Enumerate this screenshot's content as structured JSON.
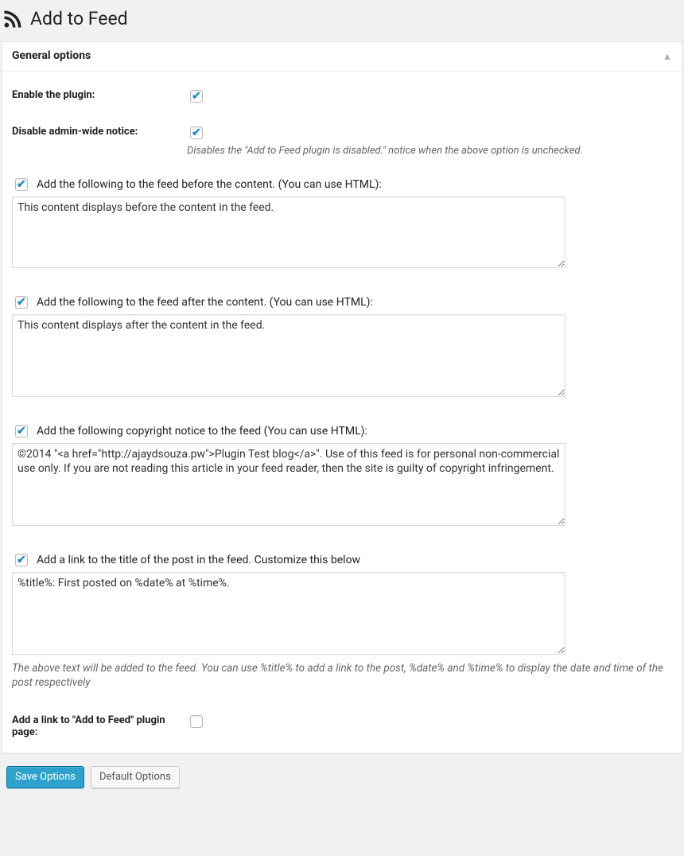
{
  "page": {
    "title": "Add to Feed"
  },
  "panel": {
    "title": "General options"
  },
  "enable": {
    "label": "Enable the plugin:",
    "checked": true
  },
  "disable_notice": {
    "label": "Disable admin-wide notice:",
    "checked": true,
    "desc": "Disables the \"Add to Feed plugin is disabled.\" notice when the above option is unchecked."
  },
  "before_content": {
    "checked": true,
    "label": "Add the following to the feed before the content. (You can use HTML):",
    "value": "This content displays before the content in the feed."
  },
  "after_content": {
    "checked": true,
    "label": "Add the following to the feed after the content. (You can use HTML):",
    "value": "This content displays after the content in the feed."
  },
  "copyright": {
    "checked": true,
    "label": "Add the following copyright notice to the feed (You can use HTML):",
    "value": "©2014 \"<a href=\"http://ajaydsouza.pw\">Plugin Test blog</a>\". Use of this feed is for personal non-commercial use only. If you are not reading this article in your feed reader, then the site is guilty of copyright infringement."
  },
  "title_link": {
    "checked": true,
    "label": "Add a link to the title of the post in the feed. Customize this below",
    "value": "%title%: First posted on %date% at %time%.",
    "help": "The above text will be added to the feed. You can use %title% to add a link to the post, %date% and %time% to display the date and time of the post respectively"
  },
  "credit_link": {
    "label": "Add a link to \"Add to Feed\" plugin page:",
    "checked": false
  },
  "buttons": {
    "save": "Save Options",
    "defaults": "Default Options"
  }
}
